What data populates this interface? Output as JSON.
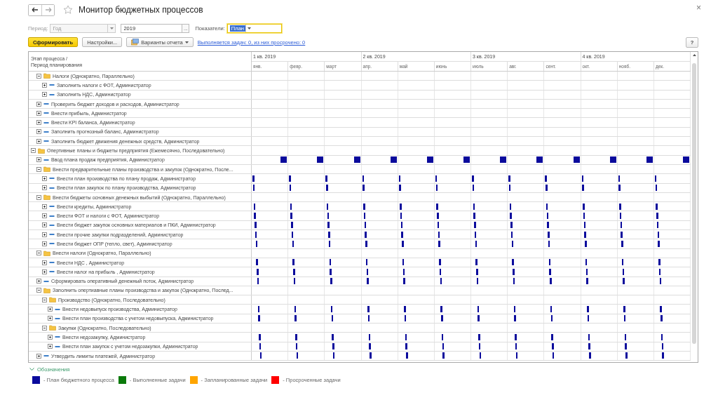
{
  "window": {
    "title": "Монитор бюджетных процессов",
    "close": "×"
  },
  "filters": {
    "period_label": "Период:",
    "period": {
      "value": "Год",
      "disabled": true
    },
    "year": {
      "value": "2019",
      "button": "..."
    },
    "indicators_label": "Показатели:",
    "indicators": {
      "value": "План",
      "selected_text": true
    }
  },
  "toolbar": {
    "buttons": [
      "Сформировать",
      "Настройки...",
      "Варианты отчета"
    ],
    "status_link": "Выполняется задач: 0, из них просрочено: 0",
    "help": "?"
  },
  "table": {
    "header": [
      "Этап процесса /",
      "Период планирования"
    ],
    "quarters": [
      "1 кв. 2019",
      "2 кв. 2019",
      "3 кв. 2019",
      "4 кв. 2019"
    ],
    "months": [
      "янв.",
      "февр.",
      "март",
      "апр.",
      "май",
      "июнь",
      "июль",
      "авг.",
      "сент.",
      "окт.",
      "нояб.",
      "дек."
    ],
    "tree": [
      {
        "kind": "continued",
        "children": [
          {
            "kind": "group",
            "label": "Налоги (Однократно, Параллельно)",
            "expanded": true,
            "children": [
              {
                "kind": "task",
                "label": "Заполнить налоги с ФОТ, Администратор",
                "expanded": false
              },
              {
                "kind": "task",
                "label": "Заполнить НДС, Администратор",
                "expanded": false
              }
            ]
          },
          {
            "kind": "task",
            "label": "Проверить бюджет доходов и расходов, Администратор",
            "expanded": false
          },
          {
            "kind": "task",
            "label": "Внести прибыль, Администратор",
            "expanded": false
          },
          {
            "kind": "task",
            "label": "Внести KPI баланса, Администратор",
            "expanded": false
          },
          {
            "kind": "task",
            "label": "Заполнить прогнозный баланс, Администратор",
            "expanded": false
          },
          {
            "kind": "task",
            "label": "Заполнить бюджет движения денежных средств, Администратор",
            "expanded": false
          }
        ]
      },
      {
        "kind": "group",
        "label": "Опертивные планы и бюджеты предприятия (Ежемесячно, Последовательно)",
        "expanded": true,
        "children": [
          {
            "kind": "task",
            "label": "Ввод плана продаж предприятия, Администратор",
            "expanded": false,
            "bar": {
              "kind": "square"
            }
          },
          {
            "kind": "group",
            "label": "Внести предварительные планы производства и закупок (Однократно, После...",
            "expanded": true,
            "children": [
              {
                "kind": "task",
                "label": "Внести план производства по плану продаж, Администратор",
                "expanded": false,
                "bar": {
                  "kind": "line"
                }
              },
              {
                "kind": "task",
                "label": "Внести план закупок по плану производства, Администратор",
                "expanded": false,
                "bar": {
                  "kind": "line"
                }
              }
            ]
          },
          {
            "kind": "group",
            "label": "Внести бюджеты основных денежных выбытий (Однократно, Параллельно)",
            "expanded": true,
            "children": [
              {
                "kind": "task",
                "label": "Внести кредиты, Администратор",
                "expanded": false,
                "bar": {
                  "kind": "line"
                }
              },
              {
                "kind": "task",
                "label": "Внести ФОТ и налоги с ФОТ, Администратор",
                "expanded": false,
                "bar": {
                  "kind": "line"
                }
              },
              {
                "kind": "task",
                "label": "Внести бюджет закупок основных материалов и ПКИ, Администратор",
                "expanded": false,
                "bar": {
                  "kind": "line"
                }
              },
              {
                "kind": "task",
                "label": "Внести прочие закупки подразделений, Администратор",
                "expanded": false,
                "bar": {
                  "kind": "line"
                }
              },
              {
                "kind": "task",
                "label": "Внести бюджет ОПР (тепло, свет), Администратор",
                "expanded": false,
                "bar": {
                  "kind": "line"
                }
              }
            ]
          },
          {
            "kind": "group",
            "label": "Внести налоги (Однократно, Параллельно)",
            "expanded": true,
            "children": [
              {
                "kind": "task",
                "label": "Внести НДС , Администратор",
                "expanded": false,
                "bar": {
                  "kind": "line"
                }
              },
              {
                "kind": "task",
                "label": "Внести налог на прибыль , Администратор",
                "expanded": false,
                "bar": {
                  "kind": "line"
                }
              }
            ]
          },
          {
            "kind": "task",
            "label": "Сформировать оперативный денежный поток, Администратор",
            "expanded": false,
            "bar": {
              "kind": "line"
            }
          },
          {
            "kind": "group",
            "label": "Заполнить опертиавные планы производства и закупок (Однократно, Послед...",
            "expanded": true,
            "children": [
              {
                "kind": "group",
                "label": "Производство (Однократно, Последовательно)",
                "expanded": true,
                "children": [
                  {
                    "kind": "task",
                    "label": "Внести недовыпуск производства, Администратор",
                    "expanded": false,
                    "bar": {
                      "kind": "line"
                    }
                  },
                  {
                    "kind": "task",
                    "label": "Внести план производства с учетом недовыпуска, Администратор",
                    "expanded": false,
                    "bar": {
                      "kind": "line"
                    }
                  }
                ]
              },
              {
                "kind": "group",
                "label": "Закупки (Однократно, Последовательно)",
                "expanded": true,
                "children": [
                  {
                    "kind": "task",
                    "label": "Внести недозакупку, Администратор",
                    "expanded": false,
                    "bar": {
                      "kind": "line"
                    }
                  },
                  {
                    "kind": "task",
                    "label": "Внести план закупок с учетом недозакупки, Администратор",
                    "expanded": false,
                    "bar": {
                      "kind": "line"
                    }
                  }
                ]
              }
            ]
          },
          {
            "kind": "task",
            "label": "Утвердить лимиты платежей, Администратор",
            "expanded": false,
            "bar": {
              "kind": "line"
            }
          }
        ]
      }
    ]
  },
  "legend": {
    "title": "Обозначения",
    "expanded": true,
    "items": [
      {
        "label": "- План бюджетного процесса",
        "color": "#0a0a9c"
      },
      {
        "label": "- Выполненные задачи",
        "color": "#0a7a0a"
      },
      {
        "label": "- Запланированные задачи",
        "color": "#ffa500"
      },
      {
        "label": "- Просроченные задачи",
        "color": "#ff0000"
      }
    ]
  }
}
